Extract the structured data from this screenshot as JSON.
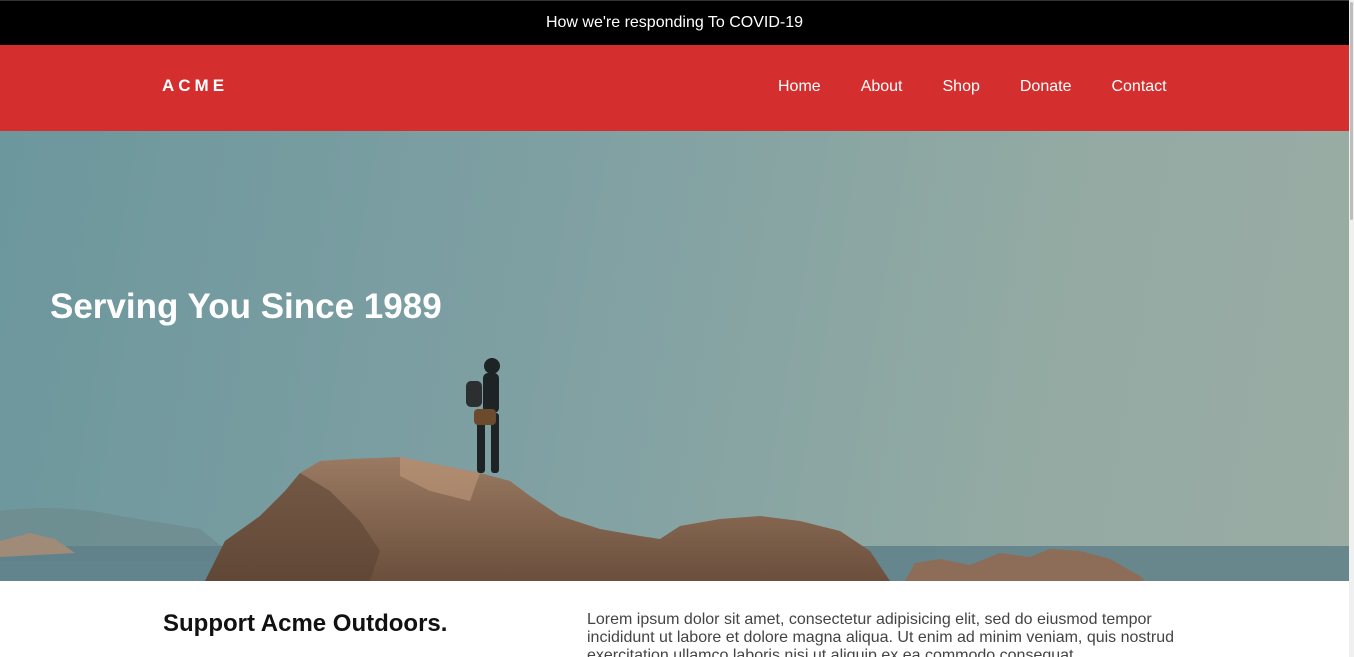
{
  "announcement": {
    "text": "How we're responding To COVID-19"
  },
  "header": {
    "logo": "ACME",
    "nav": [
      {
        "label": "Home"
      },
      {
        "label": "About"
      },
      {
        "label": "Shop"
      },
      {
        "label": "Donate"
      },
      {
        "label": "Contact"
      }
    ]
  },
  "hero": {
    "title": "Serving You Since 1989",
    "image": "hiker-on-rocky-cliff-over-sea"
  },
  "content": {
    "heading": "Support Acme Outdoors.",
    "body": "Lorem ipsum dolor sit amet, consectetur adipisicing elit, sed do eiusmod tempor incididunt ut labore et dolore magna aliqua. Ut enim ad minim veniam, quis nostrud exercitation ullamco laboris nisi ut aliquip ex ea commodo consequat."
  },
  "colors": {
    "announcement_bg": "#000000",
    "header_bg": "#d42f2e",
    "hero_sky": "#7fa0a3"
  }
}
